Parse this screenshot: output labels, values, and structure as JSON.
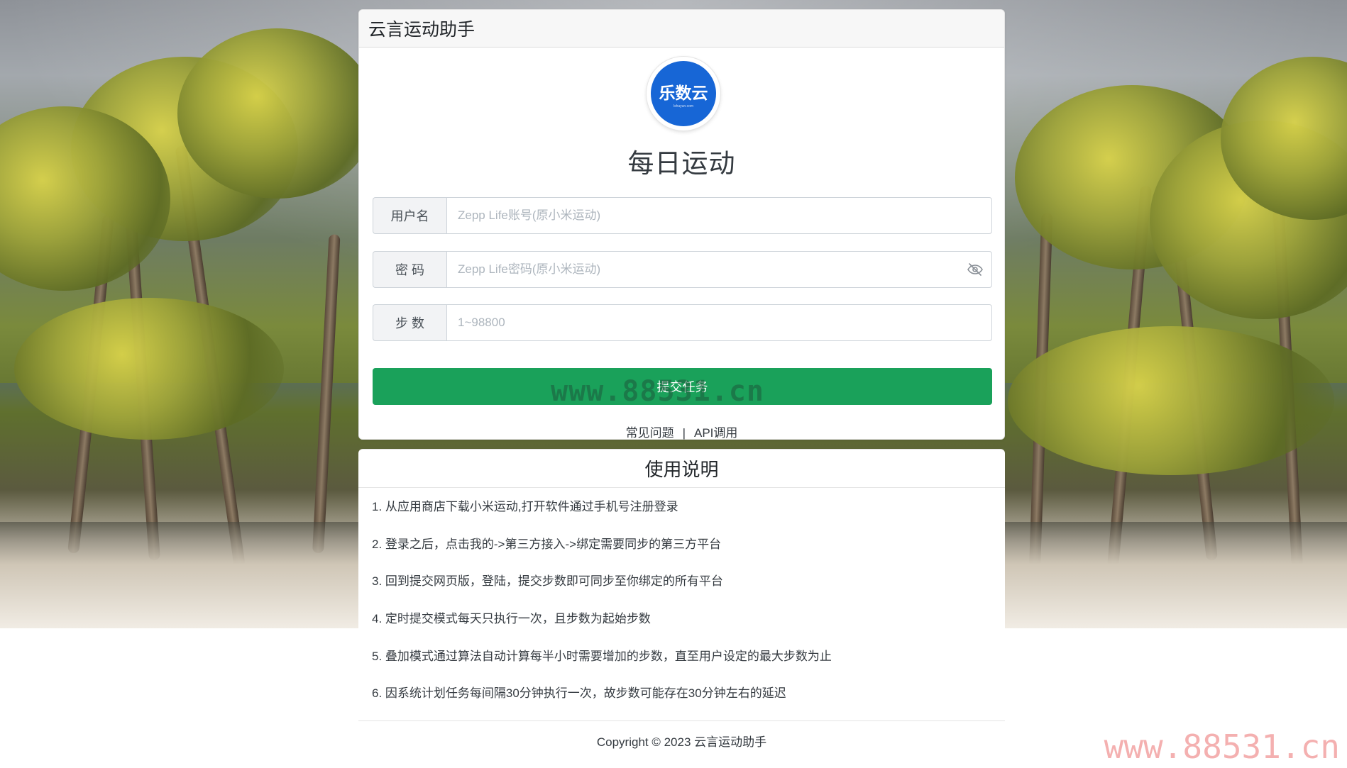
{
  "header": {
    "title": "云言运动助手"
  },
  "logo": {
    "text": "乐数云",
    "subtext": "lshuyun.com",
    "color": "#1766d6"
  },
  "main": {
    "heading": "每日运动",
    "fields": {
      "username": {
        "label": "用户名",
        "placeholder": "Zepp Life账号(原小米运动)",
        "value": ""
      },
      "password": {
        "label": "密 码",
        "placeholder": "Zepp Life密码(原小米运动)",
        "value": "",
        "toggle_icon": "eye-off-icon"
      },
      "steps": {
        "label": "步 数",
        "placeholder": "1~98800",
        "value": ""
      }
    },
    "submit_label": "提交任务",
    "submit_color": "#1aa15a",
    "links": {
      "faq": "常见问题",
      "separator": "|",
      "api": "API调用"
    }
  },
  "guide": {
    "title": "使用说明",
    "items": [
      "1. 从应用商店下载小米运动,打开软件通过手机号注册登录",
      "2. 登录之后，点击我的->第三方接入->绑定需要同步的第三方平台",
      "3. 回到提交网页版，登陆，提交步数即可同步至你绑定的所有平台",
      "4. 定时提交模式每天只执行一次，且步数为起始步数",
      "5. 叠加模式通过算法自动计算每半小时需要增加的步数，直至用户设定的最大步数为止",
      "6. 因系统计划任务每间隔30分钟执行一次，故步数可能存在30分钟左右的延迟"
    ]
  },
  "footer": {
    "copyright": "Copyright © 2023 云言运动助手"
  },
  "watermarks": {
    "mid": "www.88531.cn",
    "corner": "www.88531.cn"
  }
}
